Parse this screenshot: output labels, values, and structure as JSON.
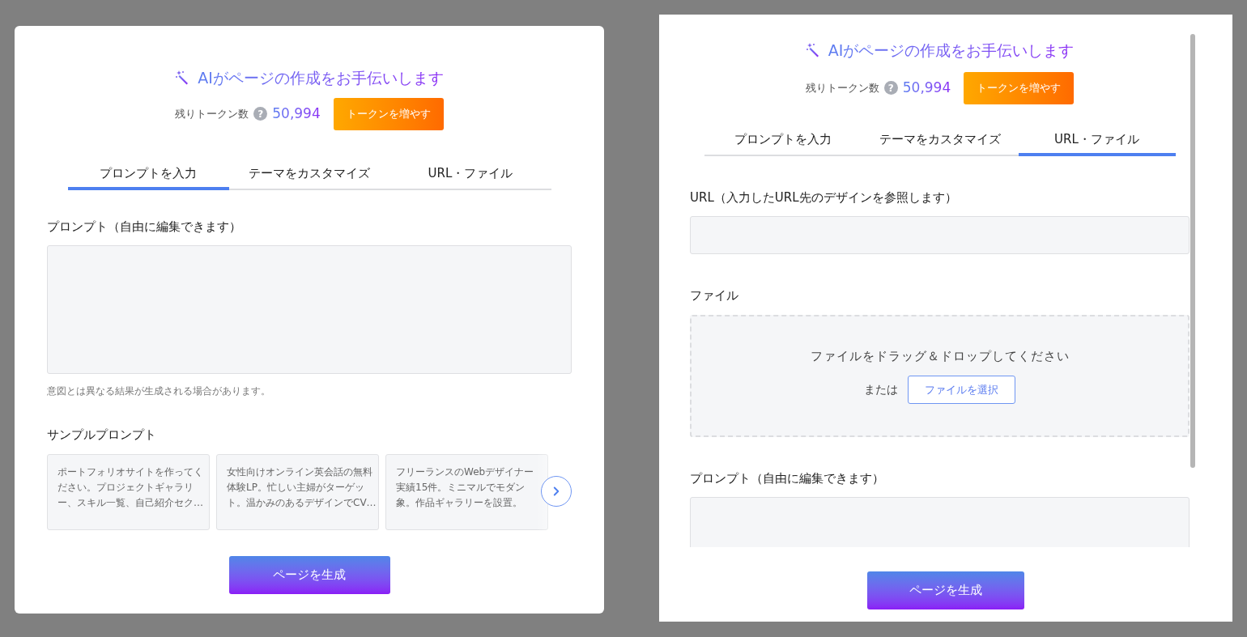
{
  "panels": [
    {
      "kind": "dialog",
      "header": {
        "title": "AIがページの作成をお手伝いします",
        "tokens_label": "残りトークン数",
        "help_icon": "?",
        "tokens": "50,994",
        "add_tokens_button": "トークンを増やす"
      },
      "tabs": [
        {
          "label": "プロンプトを入力",
          "selected": true
        },
        {
          "label": "テーマをカスタマイズ",
          "selected": false
        },
        {
          "label": "URL・ファイル",
          "selected": false
        }
      ],
      "sections": [
        {
          "kind": "textarea",
          "label": "プロンプト（自由に編集できます）",
          "note": "意図とは異なる結果が生成される場合があります。"
        },
        {
          "kind": "samples",
          "label": "サンプルプロンプト",
          "cards": [
            {
              "lines": [
                "ポートフォリオサイトを作ってく",
                "ださい。プロジェクトギャラリ",
                "ー、スキル一覧、自己紹介セク…"
              ]
            },
            {
              "lines": [
                "女性向けオンライン英会話の無料",
                "体験LP。忙しい主婦がターゲッ",
                "ト。温かみのあるデザインでCV…"
              ]
            },
            {
              "lines": [
                "フリーランスのWebデザイナー",
                "実績15件。ミニマルでモダン",
                "象。作品ギャラリーを設置。"
              ]
            }
          ]
        }
      ],
      "generate_button": "ページを生成"
    },
    {
      "kind": "scrolling",
      "header": {
        "title": "AIがページの作成をお手伝いします",
        "tokens_label": "残りトークン数",
        "help_icon": "?",
        "tokens": "50,994",
        "add_tokens_button": "トークンを増やす"
      },
      "tabs": [
        {
          "label": "プロンプトを入力",
          "selected": false
        },
        {
          "label": "テーマをカスタマイズ",
          "selected": false
        },
        {
          "label": "URL・ファイル",
          "selected": true
        }
      ],
      "sections": [
        {
          "kind": "input",
          "label": "URL（入力したURL先のデザインを参照します）"
        },
        {
          "kind": "dropzone",
          "label": "ファイル",
          "message": "ファイルをドラッグ＆ドロップしてください",
          "or": "または",
          "select_button": "ファイルを選択"
        },
        {
          "kind": "textarea",
          "label": "プロンプト（自由に編集できます）"
        }
      ],
      "generate_button": "ページを生成"
    }
  ]
}
